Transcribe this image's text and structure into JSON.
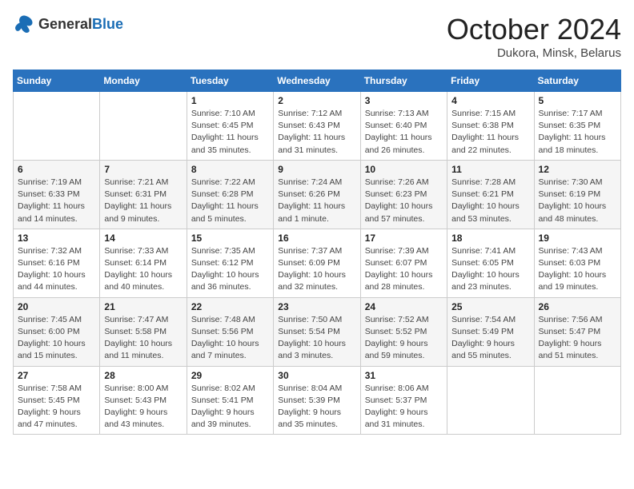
{
  "header": {
    "logo": {
      "general": "General",
      "blue": "Blue"
    },
    "title": "October 2024",
    "subtitle": "Dukora, Minsk, Belarus"
  },
  "weekdays": [
    "Sunday",
    "Monday",
    "Tuesday",
    "Wednesday",
    "Thursday",
    "Friday",
    "Saturday"
  ],
  "weeks": [
    [
      {
        "day": "",
        "detail": ""
      },
      {
        "day": "",
        "detail": ""
      },
      {
        "day": "1",
        "detail": "Sunrise: 7:10 AM\nSunset: 6:45 PM\nDaylight: 11 hours and 35 minutes."
      },
      {
        "day": "2",
        "detail": "Sunrise: 7:12 AM\nSunset: 6:43 PM\nDaylight: 11 hours and 31 minutes."
      },
      {
        "day": "3",
        "detail": "Sunrise: 7:13 AM\nSunset: 6:40 PM\nDaylight: 11 hours and 26 minutes."
      },
      {
        "day": "4",
        "detail": "Sunrise: 7:15 AM\nSunset: 6:38 PM\nDaylight: 11 hours and 22 minutes."
      },
      {
        "day": "5",
        "detail": "Sunrise: 7:17 AM\nSunset: 6:35 PM\nDaylight: 11 hours and 18 minutes."
      }
    ],
    [
      {
        "day": "6",
        "detail": "Sunrise: 7:19 AM\nSunset: 6:33 PM\nDaylight: 11 hours and 14 minutes."
      },
      {
        "day": "7",
        "detail": "Sunrise: 7:21 AM\nSunset: 6:31 PM\nDaylight: 11 hours and 9 minutes."
      },
      {
        "day": "8",
        "detail": "Sunrise: 7:22 AM\nSunset: 6:28 PM\nDaylight: 11 hours and 5 minutes."
      },
      {
        "day": "9",
        "detail": "Sunrise: 7:24 AM\nSunset: 6:26 PM\nDaylight: 11 hours and 1 minute."
      },
      {
        "day": "10",
        "detail": "Sunrise: 7:26 AM\nSunset: 6:23 PM\nDaylight: 10 hours and 57 minutes."
      },
      {
        "day": "11",
        "detail": "Sunrise: 7:28 AM\nSunset: 6:21 PM\nDaylight: 10 hours and 53 minutes."
      },
      {
        "day": "12",
        "detail": "Sunrise: 7:30 AM\nSunset: 6:19 PM\nDaylight: 10 hours and 48 minutes."
      }
    ],
    [
      {
        "day": "13",
        "detail": "Sunrise: 7:32 AM\nSunset: 6:16 PM\nDaylight: 10 hours and 44 minutes."
      },
      {
        "day": "14",
        "detail": "Sunrise: 7:33 AM\nSunset: 6:14 PM\nDaylight: 10 hours and 40 minutes."
      },
      {
        "day": "15",
        "detail": "Sunrise: 7:35 AM\nSunset: 6:12 PM\nDaylight: 10 hours and 36 minutes."
      },
      {
        "day": "16",
        "detail": "Sunrise: 7:37 AM\nSunset: 6:09 PM\nDaylight: 10 hours and 32 minutes."
      },
      {
        "day": "17",
        "detail": "Sunrise: 7:39 AM\nSunset: 6:07 PM\nDaylight: 10 hours and 28 minutes."
      },
      {
        "day": "18",
        "detail": "Sunrise: 7:41 AM\nSunset: 6:05 PM\nDaylight: 10 hours and 23 minutes."
      },
      {
        "day": "19",
        "detail": "Sunrise: 7:43 AM\nSunset: 6:03 PM\nDaylight: 10 hours and 19 minutes."
      }
    ],
    [
      {
        "day": "20",
        "detail": "Sunrise: 7:45 AM\nSunset: 6:00 PM\nDaylight: 10 hours and 15 minutes."
      },
      {
        "day": "21",
        "detail": "Sunrise: 7:47 AM\nSunset: 5:58 PM\nDaylight: 10 hours and 11 minutes."
      },
      {
        "day": "22",
        "detail": "Sunrise: 7:48 AM\nSunset: 5:56 PM\nDaylight: 10 hours and 7 minutes."
      },
      {
        "day": "23",
        "detail": "Sunrise: 7:50 AM\nSunset: 5:54 PM\nDaylight: 10 hours and 3 minutes."
      },
      {
        "day": "24",
        "detail": "Sunrise: 7:52 AM\nSunset: 5:52 PM\nDaylight: 9 hours and 59 minutes."
      },
      {
        "day": "25",
        "detail": "Sunrise: 7:54 AM\nSunset: 5:49 PM\nDaylight: 9 hours and 55 minutes."
      },
      {
        "day": "26",
        "detail": "Sunrise: 7:56 AM\nSunset: 5:47 PM\nDaylight: 9 hours and 51 minutes."
      }
    ],
    [
      {
        "day": "27",
        "detail": "Sunrise: 7:58 AM\nSunset: 5:45 PM\nDaylight: 9 hours and 47 minutes."
      },
      {
        "day": "28",
        "detail": "Sunrise: 8:00 AM\nSunset: 5:43 PM\nDaylight: 9 hours and 43 minutes."
      },
      {
        "day": "29",
        "detail": "Sunrise: 8:02 AM\nSunset: 5:41 PM\nDaylight: 9 hours and 39 minutes."
      },
      {
        "day": "30",
        "detail": "Sunrise: 8:04 AM\nSunset: 5:39 PM\nDaylight: 9 hours and 35 minutes."
      },
      {
        "day": "31",
        "detail": "Sunrise: 8:06 AM\nSunset: 5:37 PM\nDaylight: 9 hours and 31 minutes."
      },
      {
        "day": "",
        "detail": ""
      },
      {
        "day": "",
        "detail": ""
      }
    ]
  ]
}
